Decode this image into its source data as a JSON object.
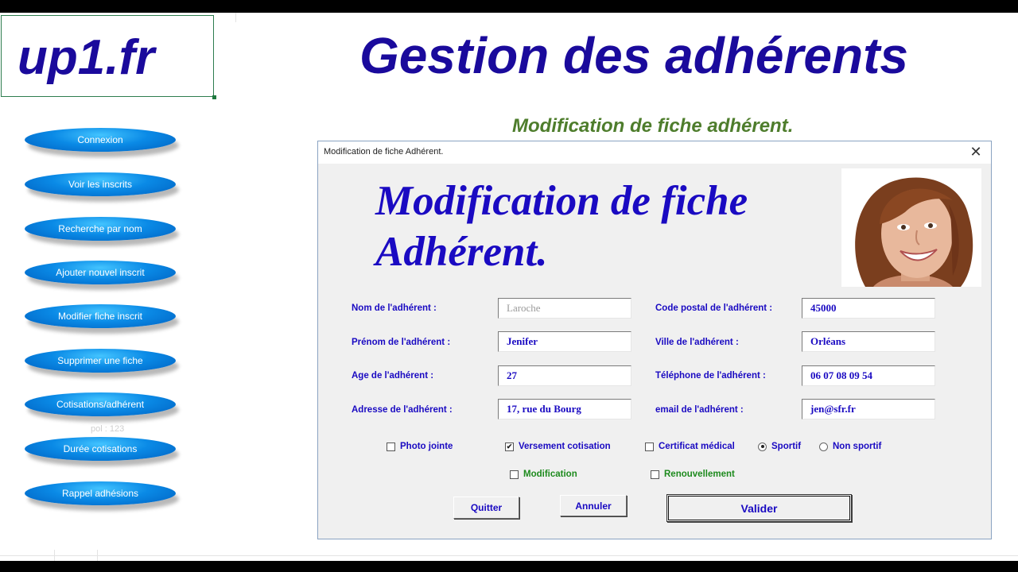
{
  "logo": "up1.fr",
  "main_title": "Gestion des adhérents",
  "subtitle": "Modification de fiche adhérent.",
  "nav_buttons": [
    "Connexion",
    "Voir les inscrits",
    "Recherche par nom",
    "Ajouter nouvel inscrit",
    "Modifier fiche inscrit",
    "Supprimer une fiche",
    "Cotisations/adhérent",
    "Durée cotisations",
    "Rappel adhésions"
  ],
  "ghost_text": "pol : 123",
  "dialog": {
    "title": "Modification de fiche Adhérent.",
    "heading_line1": "Modification de fiche",
    "heading_line2": "Adhérent.",
    "photo": "member-photo",
    "fields": {
      "nom": {
        "label": "Nom de l'adhérent :",
        "value": "Laroche"
      },
      "prenom": {
        "label": "Prénom de l'adhérent :",
        "value": "Jenifer"
      },
      "age": {
        "label": "Age de l'adhérent :",
        "value": "27"
      },
      "adresse": {
        "label": "Adresse de l'adhérent :",
        "value": "17, rue du Bourg"
      },
      "cp": {
        "label": "Code postal de l'adhérent :",
        "value": "45000"
      },
      "ville": {
        "label": "Ville de l'adhérent :",
        "value": "Orléans"
      },
      "tel": {
        "label": "Téléphone de l'adhérent :",
        "value": "06 07 08 09 54"
      },
      "email": {
        "label": "email de l'adhérent :",
        "value": "jen@sfr.fr"
      }
    },
    "options": {
      "photo": {
        "label": "Photo jointe",
        "checked": false
      },
      "versement": {
        "label": "Versement cotisation",
        "checked": true
      },
      "certificat": {
        "label": "Certificat médical",
        "checked": false
      },
      "sportif": {
        "label": "Sportif",
        "selected": true
      },
      "non_sportif": {
        "label": "Non sportif",
        "selected": false
      },
      "modification": {
        "label": "Modification",
        "checked": false
      },
      "renouvellement": {
        "label": "Renouvellement",
        "checked": false
      }
    },
    "buttons": {
      "quitter": "Quitter",
      "annuler": "Annuler",
      "valider": "Valider"
    },
    "checkmark": "✔",
    "close_glyph": "✕"
  },
  "colors": {
    "title_blue": "#1a0a9c",
    "label_blue": "#1a0ac2",
    "subtitle_green": "#4e7d2c",
    "option_green": "#1d8a1d",
    "nav_blue": "#0a8ae6"
  }
}
